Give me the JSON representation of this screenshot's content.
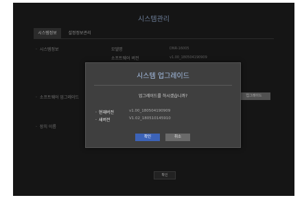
{
  "window": {
    "title": "시스템관리"
  },
  "tabs": [
    {
      "label": "시스템정보",
      "active": true
    },
    {
      "label": "설정정보관리",
      "active": false
    }
  ],
  "info": {
    "system_info_label": "시스템정보",
    "model_label": "모델명",
    "model_value": "DNR-16005",
    "software_version_label": "소프트웨어 버전",
    "software_version_value": "v1.00_180504190909",
    "software_upgrade_label": "소프트웨어 업그레이드",
    "device_name_label": "장치 이름",
    "upgrade_button": "업그레이드",
    "ok_button": "확인"
  },
  "dialog": {
    "title": "시스템 업그레이드",
    "question": "업그레이드를 하시겠습니까?",
    "current_version_label": "현재버전",
    "current_version_value": "v1.00_180504190909",
    "new_version_label": "새버전",
    "new_version_value": "V1.02_180510145910",
    "confirm_label": "확인",
    "cancel_label": "취소"
  },
  "colors": {
    "background": "#1c1c1c",
    "dialog": "#3f3f3f",
    "accent_title": "#a8c2e8",
    "confirm_button": "#3c63b8"
  }
}
